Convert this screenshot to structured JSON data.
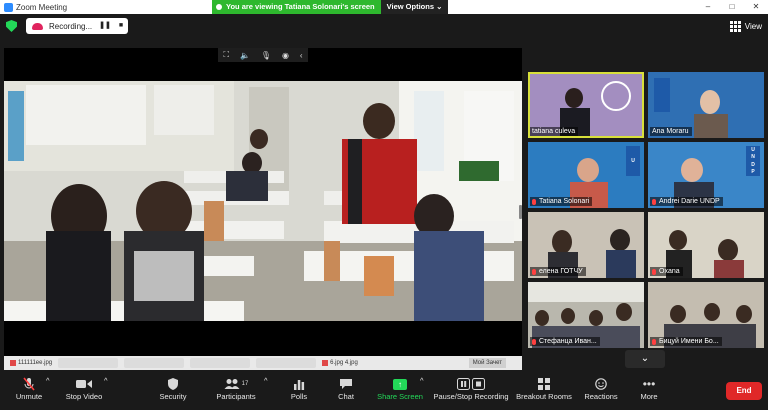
{
  "window": {
    "title": "Zoom Meeting",
    "controls": [
      "–",
      "□",
      "✕"
    ]
  },
  "recording": {
    "label": "Recording...",
    "pause_glyph": "❚❚",
    "stop_glyph": "■"
  },
  "share_banner": {
    "message": "You are viewing Tatiana Solonari's screen",
    "options_label": "View Options ⌄"
  },
  "view_button": {
    "label": "View"
  },
  "media_toolbar": {
    "items": [
      "⛶",
      "🔈",
      "🎙",
      "◉",
      "‹"
    ]
  },
  "taskbar": {
    "items": [
      "111111ee.jpg",
      "",
      "",
      "",
      "",
      "",
      "",
      "6.jpg 4.jpg"
    ],
    "right_label": "Мой Зачет"
  },
  "gallery": {
    "tiles": [
      {
        "name": "tatiana culeva",
        "mic_muted": false,
        "active": true,
        "bg": "#8a6fa8"
      },
      {
        "name": "Ana Moraru",
        "mic_muted": false,
        "active": false,
        "bg": "#2f6fb3"
      },
      {
        "name": "Tatiana Solonari",
        "mic_muted": true,
        "active": false,
        "bg": "#2c7cc0"
      },
      {
        "name": "Andrei Darie UNDP",
        "mic_muted": true,
        "active": false,
        "bg": "#3a86c8"
      },
      {
        "name": "елена ГОТЧУ",
        "mic_muted": true,
        "active": false,
        "bg": "#c9c2b6"
      },
      {
        "name": "Oxana",
        "mic_muted": true,
        "active": false,
        "bg": "#d9d4c7"
      },
      {
        "name": "Стефанца Иван...",
        "mic_muted": true,
        "active": false,
        "bg": "#b9b7ad"
      },
      {
        "name": "Бицуй Имени Бо...",
        "mic_muted": true,
        "active": false,
        "bg": "#c4bdb0"
      }
    ],
    "undp_logo_text": [
      "U",
      "N",
      "D",
      "P"
    ],
    "next_page_glyph": "⌄"
  },
  "controls": {
    "unmute": "Unmute",
    "stop_video": "Stop Video",
    "security": "Security",
    "participants": "Participants",
    "participants_count": "17",
    "polls": "Polls",
    "chat": "Chat",
    "share_screen": "Share Screen",
    "pause_recording": "Pause/Stop Recording",
    "breakout_rooms": "Breakout Rooms",
    "reactions": "Reactions",
    "more": "More",
    "end": "End"
  },
  "colors": {
    "accent_green": "#23d959",
    "end_red": "#e02828",
    "active_speaker": "#d8e03b",
    "muted_red": "#ff4040"
  }
}
